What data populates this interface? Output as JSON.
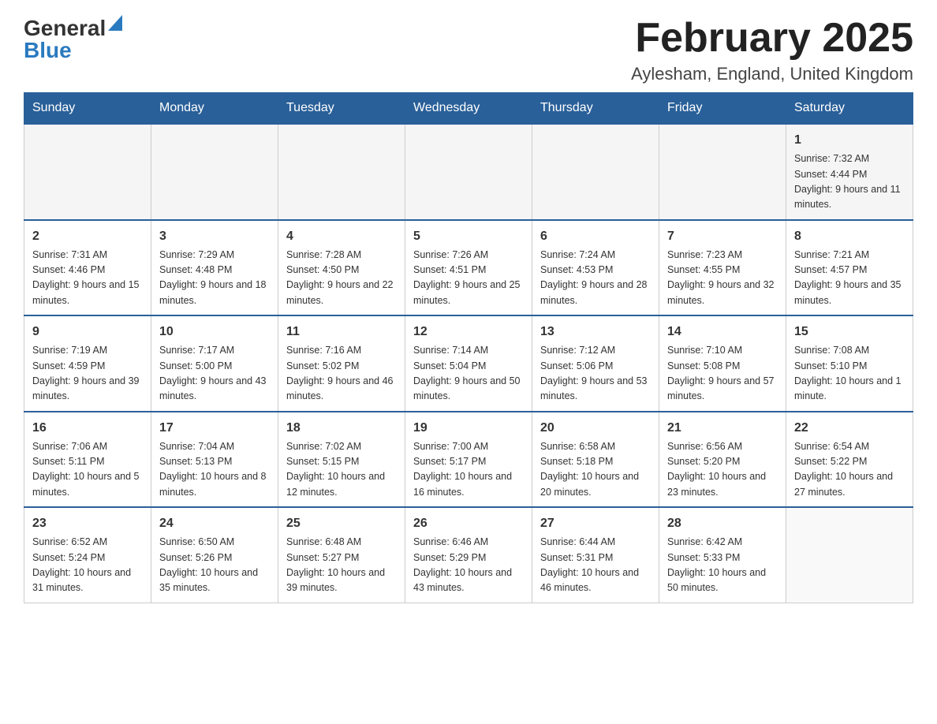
{
  "logo": {
    "text_general": "General",
    "text_blue": "Blue"
  },
  "header": {
    "month_year": "February 2025",
    "location": "Aylesham, England, United Kingdom"
  },
  "days_of_week": [
    "Sunday",
    "Monday",
    "Tuesday",
    "Wednesday",
    "Thursday",
    "Friday",
    "Saturday"
  ],
  "weeks": [
    [
      {
        "day": "",
        "sunrise": "",
        "sunset": "",
        "daylight": ""
      },
      {
        "day": "",
        "sunrise": "",
        "sunset": "",
        "daylight": ""
      },
      {
        "day": "",
        "sunrise": "",
        "sunset": "",
        "daylight": ""
      },
      {
        "day": "",
        "sunrise": "",
        "sunset": "",
        "daylight": ""
      },
      {
        "day": "",
        "sunrise": "",
        "sunset": "",
        "daylight": ""
      },
      {
        "day": "",
        "sunrise": "",
        "sunset": "",
        "daylight": ""
      },
      {
        "day": "1",
        "sunrise": "Sunrise: 7:32 AM",
        "sunset": "Sunset: 4:44 PM",
        "daylight": "Daylight: 9 hours and 11 minutes."
      }
    ],
    [
      {
        "day": "2",
        "sunrise": "Sunrise: 7:31 AM",
        "sunset": "Sunset: 4:46 PM",
        "daylight": "Daylight: 9 hours and 15 minutes."
      },
      {
        "day": "3",
        "sunrise": "Sunrise: 7:29 AM",
        "sunset": "Sunset: 4:48 PM",
        "daylight": "Daylight: 9 hours and 18 minutes."
      },
      {
        "day": "4",
        "sunrise": "Sunrise: 7:28 AM",
        "sunset": "Sunset: 4:50 PM",
        "daylight": "Daylight: 9 hours and 22 minutes."
      },
      {
        "day": "5",
        "sunrise": "Sunrise: 7:26 AM",
        "sunset": "Sunset: 4:51 PM",
        "daylight": "Daylight: 9 hours and 25 minutes."
      },
      {
        "day": "6",
        "sunrise": "Sunrise: 7:24 AM",
        "sunset": "Sunset: 4:53 PM",
        "daylight": "Daylight: 9 hours and 28 minutes."
      },
      {
        "day": "7",
        "sunrise": "Sunrise: 7:23 AM",
        "sunset": "Sunset: 4:55 PM",
        "daylight": "Daylight: 9 hours and 32 minutes."
      },
      {
        "day": "8",
        "sunrise": "Sunrise: 7:21 AM",
        "sunset": "Sunset: 4:57 PM",
        "daylight": "Daylight: 9 hours and 35 minutes."
      }
    ],
    [
      {
        "day": "9",
        "sunrise": "Sunrise: 7:19 AM",
        "sunset": "Sunset: 4:59 PM",
        "daylight": "Daylight: 9 hours and 39 minutes."
      },
      {
        "day": "10",
        "sunrise": "Sunrise: 7:17 AM",
        "sunset": "Sunset: 5:00 PM",
        "daylight": "Daylight: 9 hours and 43 minutes."
      },
      {
        "day": "11",
        "sunrise": "Sunrise: 7:16 AM",
        "sunset": "Sunset: 5:02 PM",
        "daylight": "Daylight: 9 hours and 46 minutes."
      },
      {
        "day": "12",
        "sunrise": "Sunrise: 7:14 AM",
        "sunset": "Sunset: 5:04 PM",
        "daylight": "Daylight: 9 hours and 50 minutes."
      },
      {
        "day": "13",
        "sunrise": "Sunrise: 7:12 AM",
        "sunset": "Sunset: 5:06 PM",
        "daylight": "Daylight: 9 hours and 53 minutes."
      },
      {
        "day": "14",
        "sunrise": "Sunrise: 7:10 AM",
        "sunset": "Sunset: 5:08 PM",
        "daylight": "Daylight: 9 hours and 57 minutes."
      },
      {
        "day": "15",
        "sunrise": "Sunrise: 7:08 AM",
        "sunset": "Sunset: 5:10 PM",
        "daylight": "Daylight: 10 hours and 1 minute."
      }
    ],
    [
      {
        "day": "16",
        "sunrise": "Sunrise: 7:06 AM",
        "sunset": "Sunset: 5:11 PM",
        "daylight": "Daylight: 10 hours and 5 minutes."
      },
      {
        "day": "17",
        "sunrise": "Sunrise: 7:04 AM",
        "sunset": "Sunset: 5:13 PM",
        "daylight": "Daylight: 10 hours and 8 minutes."
      },
      {
        "day": "18",
        "sunrise": "Sunrise: 7:02 AM",
        "sunset": "Sunset: 5:15 PM",
        "daylight": "Daylight: 10 hours and 12 minutes."
      },
      {
        "day": "19",
        "sunrise": "Sunrise: 7:00 AM",
        "sunset": "Sunset: 5:17 PM",
        "daylight": "Daylight: 10 hours and 16 minutes."
      },
      {
        "day": "20",
        "sunrise": "Sunrise: 6:58 AM",
        "sunset": "Sunset: 5:18 PM",
        "daylight": "Daylight: 10 hours and 20 minutes."
      },
      {
        "day": "21",
        "sunrise": "Sunrise: 6:56 AM",
        "sunset": "Sunset: 5:20 PM",
        "daylight": "Daylight: 10 hours and 23 minutes."
      },
      {
        "day": "22",
        "sunrise": "Sunrise: 6:54 AM",
        "sunset": "Sunset: 5:22 PM",
        "daylight": "Daylight: 10 hours and 27 minutes."
      }
    ],
    [
      {
        "day": "23",
        "sunrise": "Sunrise: 6:52 AM",
        "sunset": "Sunset: 5:24 PM",
        "daylight": "Daylight: 10 hours and 31 minutes."
      },
      {
        "day": "24",
        "sunrise": "Sunrise: 6:50 AM",
        "sunset": "Sunset: 5:26 PM",
        "daylight": "Daylight: 10 hours and 35 minutes."
      },
      {
        "day": "25",
        "sunrise": "Sunrise: 6:48 AM",
        "sunset": "Sunset: 5:27 PM",
        "daylight": "Daylight: 10 hours and 39 minutes."
      },
      {
        "day": "26",
        "sunrise": "Sunrise: 6:46 AM",
        "sunset": "Sunset: 5:29 PM",
        "daylight": "Daylight: 10 hours and 43 minutes."
      },
      {
        "day": "27",
        "sunrise": "Sunrise: 6:44 AM",
        "sunset": "Sunset: 5:31 PM",
        "daylight": "Daylight: 10 hours and 46 minutes."
      },
      {
        "day": "28",
        "sunrise": "Sunrise: 6:42 AM",
        "sunset": "Sunset: 5:33 PM",
        "daylight": "Daylight: 10 hours and 50 minutes."
      },
      {
        "day": "",
        "sunrise": "",
        "sunset": "",
        "daylight": ""
      }
    ]
  ]
}
